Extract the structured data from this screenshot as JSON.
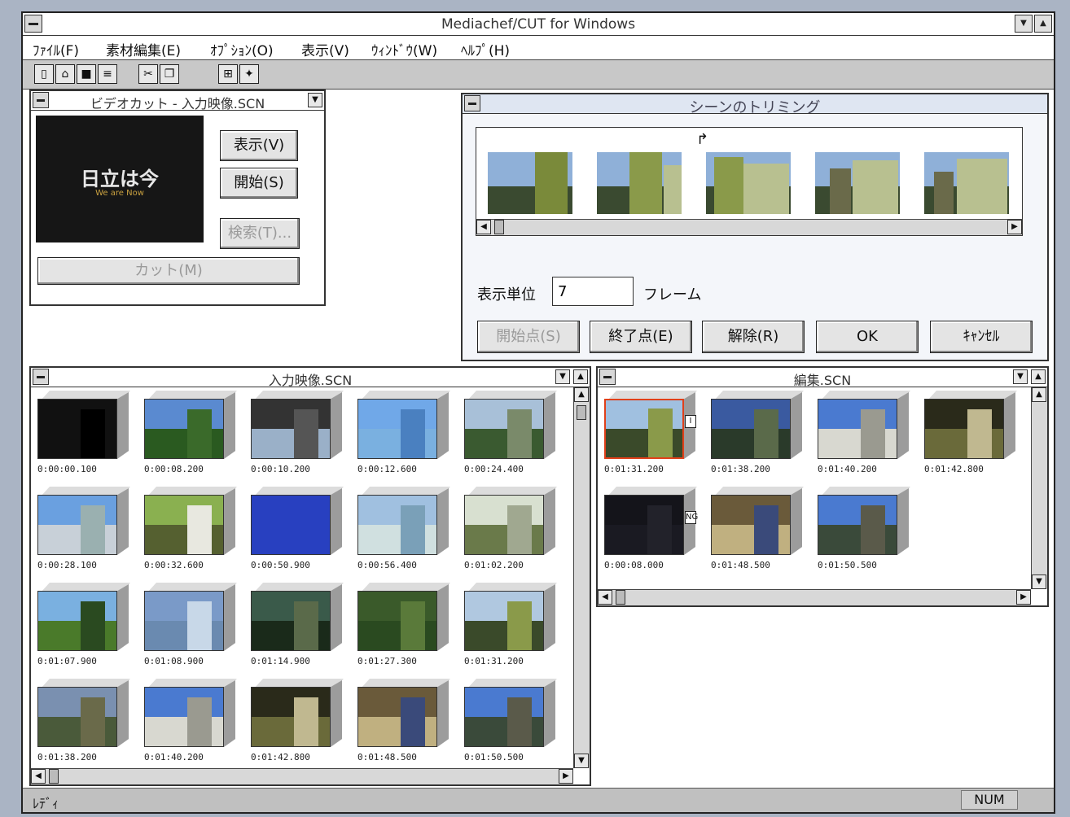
{
  "window": {
    "title": "Mediachef/CUT for Windows"
  },
  "menubar": [
    "ﾌｧｲﾙ(F)",
    "素材編集(E)",
    "ｵﾌﾟｼｮﾝ(O)",
    "表示(V)",
    "ｳｨﾝﾄﾞｳ(W)",
    "ﾍﾙﾌﾟ(H)"
  ],
  "toolbar": [
    "new-icon",
    "open-icon",
    "save-icon",
    "print-icon",
    "cut-icon",
    "copy-icon",
    "scene-icon",
    "settings-icon"
  ],
  "video_cut": {
    "title": "ビデオカット - 入力映像.SCN",
    "preview_text": "日立は今",
    "preview_sub": "We are Now",
    "btn_show": "表示(V)",
    "btn_start": "開始(S)",
    "btn_detect": "検索(T)...",
    "btn_cut": "カット(M)"
  },
  "trim": {
    "title": "シーンのトリミング",
    "unit_label": "表示単位",
    "unit_value": "7",
    "unit_suffix": "フレーム",
    "btn_start_point": "開始点(S)",
    "btn_end_point": "終了点(E)",
    "btn_release": "解除(R)",
    "btn_ok": "OK",
    "btn_cancel": "ｷｬﾝｾﾙ"
  },
  "input_scn": {
    "title": "入力映像.SCN",
    "clips": [
      "0:00:00.100",
      "0:00:08.200",
      "0:00:10.200",
      "0:00:12.600",
      "0:00:24.400",
      "0:00:28.100",
      "0:00:32.600",
      "0:00:50.900",
      "0:00:56.400",
      "0:01:02.200",
      "0:01:07.900",
      "0:01:08.900",
      "0:01:14.900",
      "0:01:27.300",
      "0:01:31.200",
      "0:01:38.200",
      "0:01:40.200",
      "0:01:42.800",
      "0:01:48.500",
      "0:01:50.500"
    ]
  },
  "edit_scn": {
    "title": "編集.SCN",
    "clips": [
      "0:01:31.200",
      "0:01:38.200",
      "0:01:40.200",
      "0:01:42.800",
      "0:00:08.000",
      "0:01:48.500",
      "0:01:50.500"
    ],
    "marker_first": "I",
    "marker_ng": "NG"
  },
  "status": {
    "text": "ﾚﾃﾞｨ",
    "num": "NUM"
  }
}
